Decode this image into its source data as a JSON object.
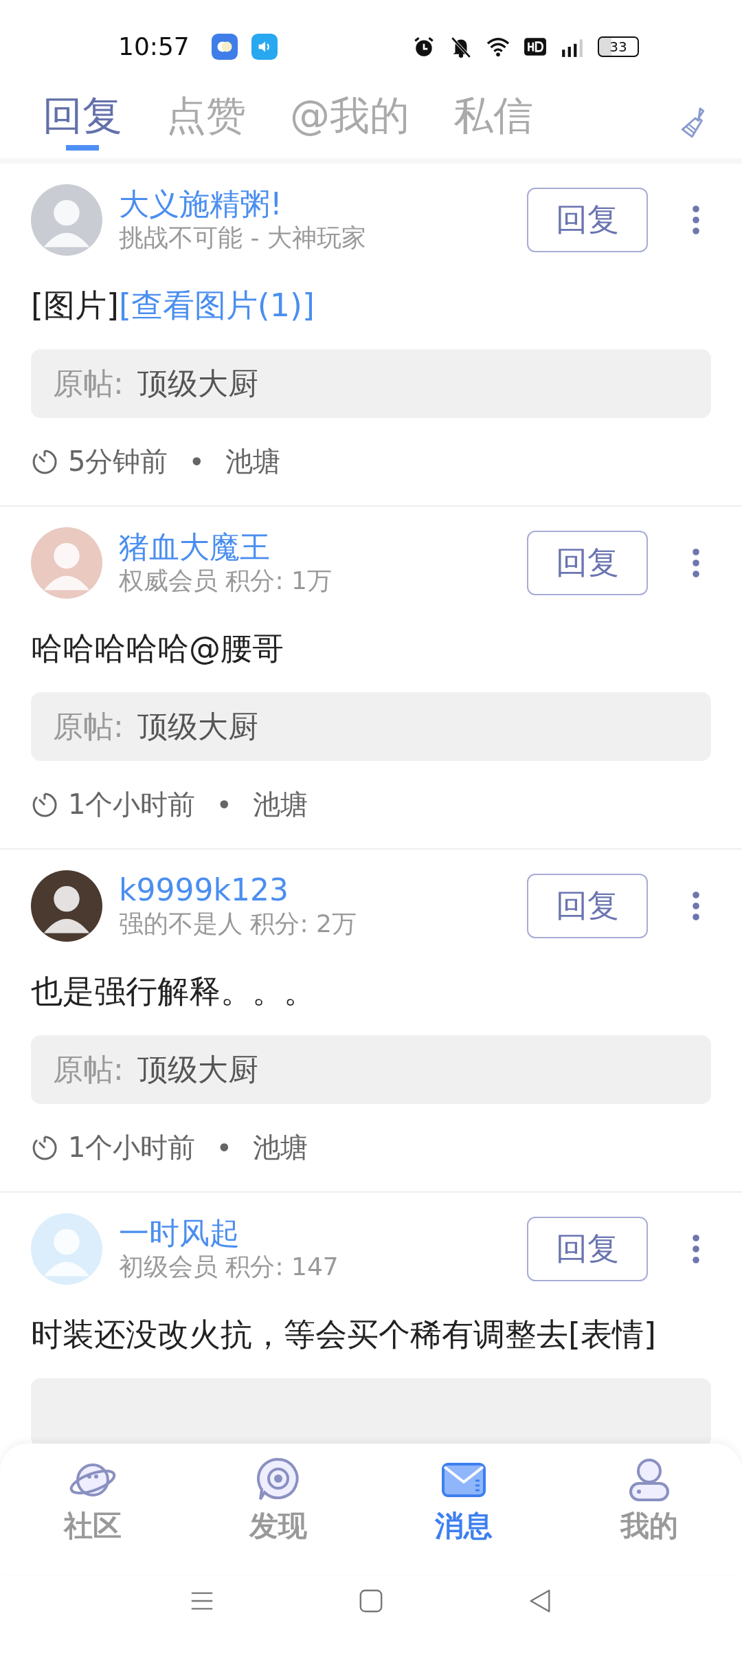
{
  "status_bar": {
    "time": "10:57",
    "battery": "33"
  },
  "tabs": [
    {
      "label": "回复",
      "selected": true
    },
    {
      "label": "点赞",
      "selected": false
    },
    {
      "label": "@我的",
      "selected": false
    },
    {
      "label": "私信",
      "selected": false
    }
  ],
  "messages": [
    {
      "name": "大义施精粥!",
      "subtitle": "挑战不可能 - 大神玩家",
      "button": "回复",
      "body": "[图片]",
      "link": "[查看图片(1)]",
      "origin_label": "原帖:",
      "origin": "顶级大厨",
      "time": "5分钟前",
      "dot": "•",
      "board": "池塘"
    },
    {
      "name": "猪血大魔王",
      "subtitle": "权威会员 积分: 1万",
      "button": "回复",
      "body": "哈哈哈哈哈@腰哥",
      "origin_label": "原帖:",
      "origin": "顶级大厨",
      "time": "1个小时前",
      "dot": "•",
      "board": "池塘"
    },
    {
      "name": "k9999k123",
      "subtitle": "强的不是人 积分: 2万",
      "button": "回复",
      "body": "也是强行解释。。。",
      "origin_label": "原帖:",
      "origin": "顶级大厨",
      "time": "1个小时前",
      "dot": "•",
      "board": "池塘"
    },
    {
      "name": "一时风起",
      "subtitle": "初级会员 积分: 147",
      "button": "回复",
      "body": "时装还没改火抗，等会买个稀有调整去[表情]"
    }
  ],
  "bottom_nav": [
    {
      "label": "社区",
      "selected": false,
      "kind": "planet"
    },
    {
      "label": "发现",
      "selected": false,
      "kind": "discover"
    },
    {
      "label": "消息",
      "selected": true,
      "kind": "mail"
    },
    {
      "label": "我的",
      "selected": false,
      "kind": "person"
    }
  ]
}
